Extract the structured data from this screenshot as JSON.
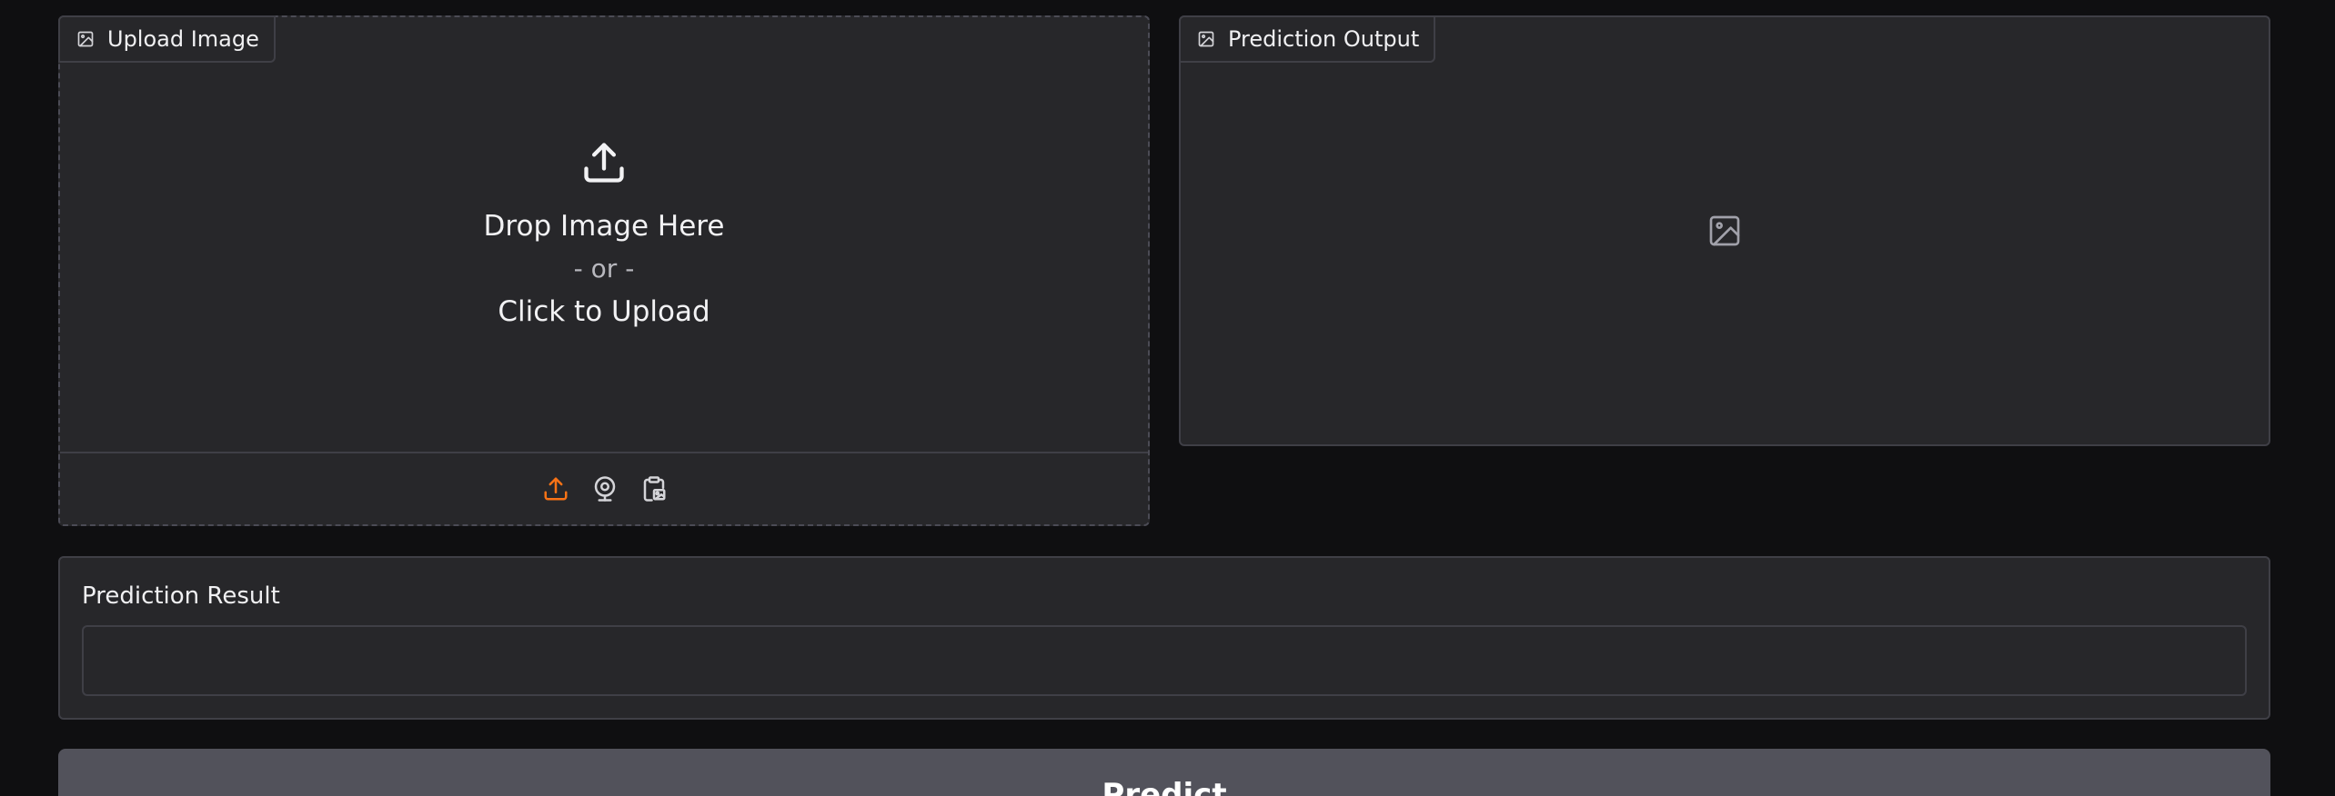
{
  "upload": {
    "label": "Upload Image",
    "drop_text": "Drop Image Here",
    "or_text": "- or -",
    "click_text": "Click to Upload",
    "sources": [
      "upload-icon",
      "webcam-icon",
      "clipboard-icon"
    ],
    "active_source_color": "#f97316"
  },
  "output": {
    "label": "Prediction Output",
    "placeholder_icon": "image-icon"
  },
  "result": {
    "label": "Prediction Result",
    "value": ""
  },
  "actions": {
    "predict_label": "Predict"
  },
  "theme": {
    "background": "#0f0f11",
    "panel": "#27272a",
    "border": "#3f3f46",
    "button": "#52525b"
  }
}
